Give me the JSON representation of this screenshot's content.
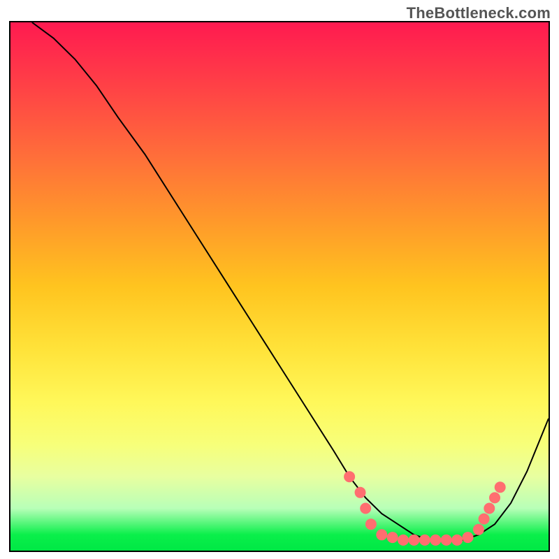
{
  "attribution": "TheBottleneck.com",
  "chart_data": {
    "type": "line",
    "title": "",
    "xlabel": "",
    "ylabel": "",
    "xlim": [
      0,
      100
    ],
    "ylim": [
      0,
      100
    ],
    "background_gradient_stops": [
      {
        "pos": 0,
        "color": "#ff1a50"
      },
      {
        "pos": 10,
        "color": "#ff3a48"
      },
      {
        "pos": 25,
        "color": "#ff6d3a"
      },
      {
        "pos": 38,
        "color": "#ff9a2a"
      },
      {
        "pos": 50,
        "color": "#ffc41f"
      },
      {
        "pos": 62,
        "color": "#ffe33a"
      },
      {
        "pos": 72,
        "color": "#fff85a"
      },
      {
        "pos": 80,
        "color": "#f7ff7a"
      },
      {
        "pos": 86,
        "color": "#e8ffa0"
      },
      {
        "pos": 92,
        "color": "#b8ffb8"
      },
      {
        "pos": 97,
        "color": "#0aef4a"
      },
      {
        "pos": 100,
        "color": "#00e845"
      }
    ],
    "series": [
      {
        "name": "bottleneck-curve",
        "color": "#000000",
        "stroke_width": 2,
        "x": [
          4,
          8,
          12,
          16,
          20,
          25,
          30,
          35,
          40,
          45,
          50,
          55,
          60,
          63,
          66,
          69,
          72,
          75,
          78,
          81,
          84,
          87,
          90,
          93,
          96,
          100
        ],
        "y": [
          100,
          97,
          93,
          88,
          82,
          75,
          67,
          59,
          51,
          43,
          35,
          27,
          19,
          14,
          10,
          7,
          5,
          3,
          2,
          2,
          2,
          3,
          5,
          9,
          15,
          25
        ]
      }
    ],
    "markers": {
      "name": "curve-dots",
      "color": "#ff6e70",
      "radius": 8,
      "points": [
        {
          "x": 63,
          "y": 14
        },
        {
          "x": 65,
          "y": 11
        },
        {
          "x": 66,
          "y": 8
        },
        {
          "x": 67,
          "y": 5
        },
        {
          "x": 69,
          "y": 3
        },
        {
          "x": 71,
          "y": 2.5
        },
        {
          "x": 73,
          "y": 2
        },
        {
          "x": 75,
          "y": 2
        },
        {
          "x": 77,
          "y": 2
        },
        {
          "x": 79,
          "y": 2
        },
        {
          "x": 81,
          "y": 2
        },
        {
          "x": 83,
          "y": 2
        },
        {
          "x": 85,
          "y": 2.5
        },
        {
          "x": 87,
          "y": 4
        },
        {
          "x": 88,
          "y": 6
        },
        {
          "x": 89,
          "y": 8
        },
        {
          "x": 90,
          "y": 10
        },
        {
          "x": 91,
          "y": 12
        }
      ]
    }
  }
}
